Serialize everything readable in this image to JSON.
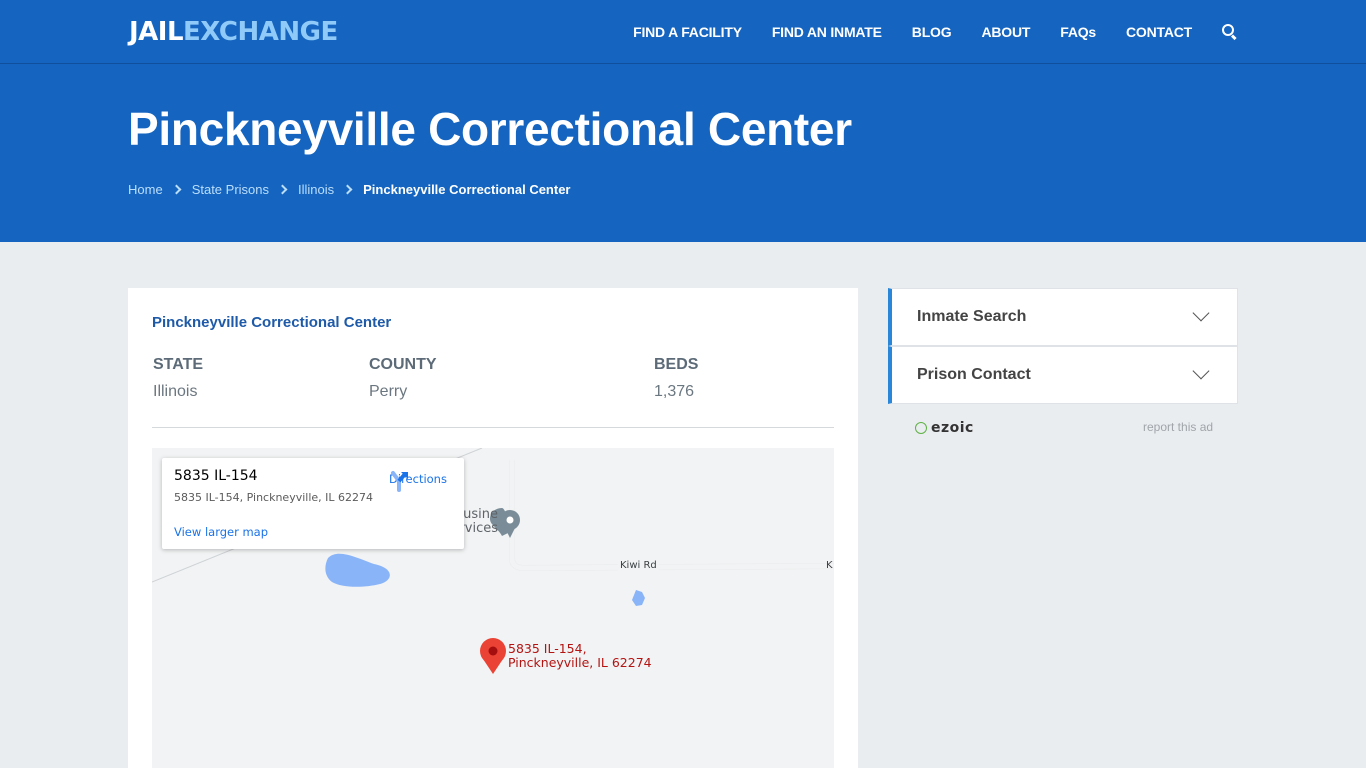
{
  "brand": {
    "part1": "JAIL",
    "part2": "EXCHANGE"
  },
  "nav": {
    "items": [
      {
        "label": "FIND A FACILITY"
      },
      {
        "label": "FIND AN INMATE"
      },
      {
        "label": "BLOG"
      },
      {
        "label": "ABOUT"
      },
      {
        "label": "FAQs"
      },
      {
        "label": "CONTACT"
      }
    ],
    "search_icon": "search-icon"
  },
  "hero": {
    "title": "Pinckneyville Correctional Center",
    "breadcrumb": [
      {
        "label": "Home"
      },
      {
        "label": "State Prisons"
      },
      {
        "label": "Illinois"
      },
      {
        "label": "Pinckneyville Correctional Center"
      }
    ]
  },
  "facility": {
    "title": "Pinckneyville Correctional Center",
    "facts": [
      {
        "label": "STATE",
        "value": "Illinois"
      },
      {
        "label": "COUNTY",
        "value": "Perry"
      },
      {
        "label": "BEDS",
        "value": "1,376"
      }
    ]
  },
  "map": {
    "info_name": "5835 IL-154",
    "info_address": "5835 IL-154, Pinckneyville, IL 62274",
    "directions_label": "Directions",
    "larger_map_label": "View larger map",
    "business_label_line1": "usine",
    "business_label_line2": "rvices",
    "road_label": "Kiwi Rd",
    "road_label_edge": "K",
    "pin_label_line1": "5835 IL-154,",
    "pin_label_line2": "Pinckneyville, IL 62274"
  },
  "sidebar": {
    "accordions": [
      {
        "label": "Inmate Search"
      },
      {
        "label": "Prison Contact"
      }
    ],
    "ad_brand": "ezoic",
    "report_ad": "report this ad"
  },
  "colors": {
    "brand_blue": "#1565c0",
    "accent_light_blue": "#90caf9",
    "title_blue": "#1e5aa8",
    "accordion_accent": "#2a86d8",
    "pin_red": "#ea4335"
  }
}
